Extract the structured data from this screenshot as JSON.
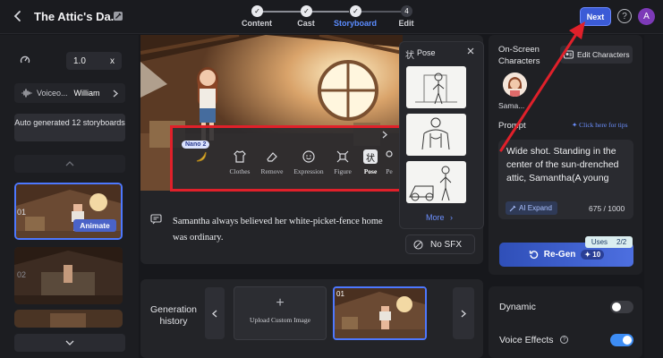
{
  "header": {
    "title": "The Attic's Da...",
    "steps": [
      {
        "label": "Content",
        "state": "done"
      },
      {
        "label": "Cast",
        "state": "done"
      },
      {
        "label": "Storyboard",
        "state": "active"
      },
      {
        "label": "Edit",
        "state": "todo",
        "number": "4"
      }
    ],
    "next_label": "Next",
    "help_glyph": "?",
    "avatar_letter": "A"
  },
  "left": {
    "speed_value": "1.0",
    "speed_suffix": "x",
    "voice_label": "Voiceo...",
    "voice_name": "William",
    "auto_generated": "Auto generated 12 storyboards",
    "thumbs": [
      {
        "num": "01",
        "selected": true
      },
      {
        "num": "02",
        "selected": false
      },
      {
        "num": "",
        "selected": false
      }
    ],
    "animate_label": "Animate"
  },
  "toolbar": {
    "nano_badge": "Nano 2",
    "tools": [
      {
        "label": "",
        "icon": "banana-icon"
      },
      {
        "label": "Clothes",
        "icon": "shirt-icon"
      },
      {
        "label": "Remove",
        "icon": "eraser-icon"
      },
      {
        "label": "Expression",
        "icon": "smile-icon"
      },
      {
        "label": "Figure",
        "icon": "figure-icon"
      },
      {
        "label": "Pose",
        "icon": "pose-icon",
        "glyph": "状"
      },
      {
        "label": "Pe",
        "icon": "person-icon"
      }
    ]
  },
  "caption": "Samantha always believed her white-picket-fence home was ordinary.",
  "pose_panel": {
    "glyph": "状",
    "title": "Pose",
    "more": "More"
  },
  "no_sfx": "No SFX",
  "generation": {
    "label": "Generation history",
    "upload": "Upload Custom Image",
    "thumb_num": "01"
  },
  "right": {
    "on_screen": "On-Screen Characters",
    "edit_characters": "Edit Characters",
    "character_name": "Sama...",
    "prompt_label": "Prompt",
    "tips": "Click here for tips",
    "prompt_text": "Wide shot. Standing in the center of the sun-drenched attic, Samantha(A young",
    "ai_expand": "AI Expand",
    "char_count": "675 / 1000",
    "regen": "Re-Gen",
    "regen_cost": "10",
    "uses_label": "Uses",
    "uses_value": "2/2",
    "dynamic": "Dynamic",
    "dynamic_on": false,
    "voice_effects": "Voice Effects",
    "voice_effects_on": true,
    "info_glyph": "?"
  },
  "colors": {
    "accent": "#3b5bd6",
    "highlight_frame": "#e0202a",
    "link": "#6c90ff"
  }
}
